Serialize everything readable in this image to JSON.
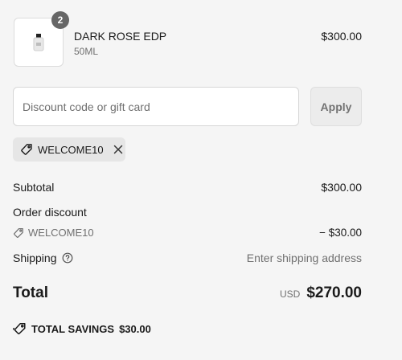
{
  "product": {
    "quantity": "2",
    "name": "DARK ROSE EDP",
    "variant": "50ML",
    "price": "$300.00"
  },
  "discount": {
    "placeholder": "Discount code or gift card",
    "value": "",
    "apply_label": "Apply",
    "applied_code": "WELCOME10"
  },
  "summary": {
    "subtotal_label": "Subtotal",
    "subtotal_value": "$300.00",
    "order_discount_label": "Order discount",
    "discount_code": "WELCOME10",
    "discount_value": "− $30.00",
    "shipping_label": "Shipping",
    "shipping_value": "Enter shipping address",
    "total_label": "Total",
    "currency": "USD",
    "total_value": "$270.00",
    "savings_label": "TOTAL SAVINGS",
    "savings_value": "$30.00"
  },
  "icons": {
    "tag": "tag-icon",
    "close": "close-icon",
    "help": "help-circle-icon",
    "savings": "savings-tag-icon"
  },
  "colors": {
    "background": "#f5f5f5",
    "muted_text": "#707070",
    "badge": "#666666"
  }
}
